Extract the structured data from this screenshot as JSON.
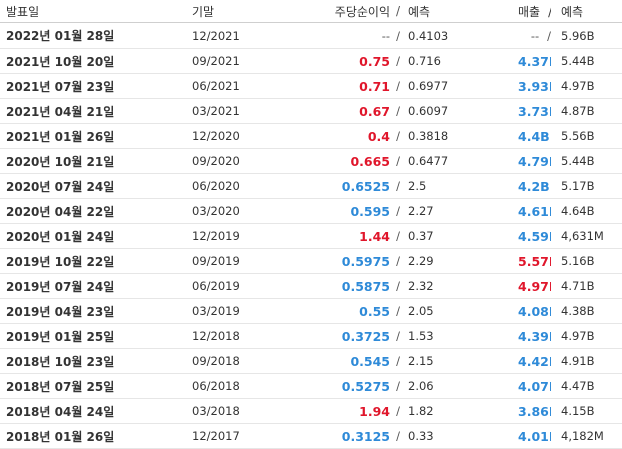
{
  "headers": {
    "date": "발표일",
    "period": "기말",
    "eps": "주당순이익",
    "eps_sep": "/",
    "eps_forecast": "예측",
    "revenue": "매출",
    "rev_sep": "/",
    "rev_forecast": "예측"
  },
  "colors": {
    "beat": "#e0162b",
    "miss": "#2e8ad8"
  },
  "rows": [
    {
      "date": "2022년 01월 28일",
      "period": "12/2021",
      "eps": "--",
      "eps_status": "na",
      "eps_forecast": "0.4103",
      "revenue": "--",
      "rev_status": "na",
      "rev_forecast": "5.96B"
    },
    {
      "date": "2021년 10월 20일",
      "period": "09/2021",
      "eps": "0.75",
      "eps_status": "up",
      "eps_forecast": "0.716",
      "revenue": "4.37B",
      "rev_status": "down",
      "rev_forecast": "5.44B"
    },
    {
      "date": "2021년 07월 23일",
      "period": "06/2021",
      "eps": "0.71",
      "eps_status": "up",
      "eps_forecast": "0.6977",
      "revenue": "3.93B",
      "rev_status": "down",
      "rev_forecast": "4.97B"
    },
    {
      "date": "2021년 04월 21일",
      "period": "03/2021",
      "eps": "0.67",
      "eps_status": "up",
      "eps_forecast": "0.6097",
      "revenue": "3.73B",
      "rev_status": "down",
      "rev_forecast": "4.87B"
    },
    {
      "date": "2021년 01월 26일",
      "period": "12/2020",
      "eps": "0.4",
      "eps_status": "up",
      "eps_forecast": "0.3818",
      "revenue": "4.4B",
      "rev_status": "down",
      "rev_forecast": "5.56B"
    },
    {
      "date": "2020년 10월 21일",
      "period": "09/2020",
      "eps": "0.665",
      "eps_status": "up",
      "eps_forecast": "0.6477",
      "revenue": "4.79B",
      "rev_status": "down",
      "rev_forecast": "5.44B"
    },
    {
      "date": "2020년 07월 24일",
      "period": "06/2020",
      "eps": "0.6525",
      "eps_status": "down",
      "eps_forecast": "2.5",
      "revenue": "4.2B",
      "rev_status": "down",
      "rev_forecast": "5.17B"
    },
    {
      "date": "2020년 04월 22일",
      "period": "03/2020",
      "eps": "0.595",
      "eps_status": "down",
      "eps_forecast": "2.27",
      "revenue": "4.61B",
      "rev_status": "down",
      "rev_forecast": "4.64B"
    },
    {
      "date": "2020년 01월 24일",
      "period": "12/2019",
      "eps": "1.44",
      "eps_status": "up",
      "eps_forecast": "0.37",
      "revenue": "4.59B",
      "rev_status": "down",
      "rev_forecast": "4,631M"
    },
    {
      "date": "2019년 10월 22일",
      "period": "09/2019",
      "eps": "0.5975",
      "eps_status": "down",
      "eps_forecast": "2.29",
      "revenue": "5.57B",
      "rev_status": "up",
      "rev_forecast": "5.16B"
    },
    {
      "date": "2019년 07월 24일",
      "period": "06/2019",
      "eps": "0.5875",
      "eps_status": "down",
      "eps_forecast": "2.32",
      "revenue": "4.97B",
      "rev_status": "up",
      "rev_forecast": "4.71B"
    },
    {
      "date": "2019년 04월 23일",
      "period": "03/2019",
      "eps": "0.55",
      "eps_status": "down",
      "eps_forecast": "2.05",
      "revenue": "4.08B",
      "rev_status": "down",
      "rev_forecast": "4.38B"
    },
    {
      "date": "2019년 01월 25일",
      "period": "12/2018",
      "eps": "0.3725",
      "eps_status": "down",
      "eps_forecast": "1.53",
      "revenue": "4.39B",
      "rev_status": "down",
      "rev_forecast": "4.97B"
    },
    {
      "date": "2018년 10월 23일",
      "period": "09/2018",
      "eps": "0.545",
      "eps_status": "down",
      "eps_forecast": "2.15",
      "revenue": "4.42B",
      "rev_status": "down",
      "rev_forecast": "4.91B"
    },
    {
      "date": "2018년 07월 25일",
      "period": "06/2018",
      "eps": "0.5275",
      "eps_status": "down",
      "eps_forecast": "2.06",
      "revenue": "4.07B",
      "rev_status": "down",
      "rev_forecast": "4.47B"
    },
    {
      "date": "2018년 04월 24일",
      "period": "03/2018",
      "eps": "1.94",
      "eps_status": "up",
      "eps_forecast": "1.82",
      "revenue": "3.86B",
      "rev_status": "down",
      "rev_forecast": "4.15B"
    },
    {
      "date": "2018년 01월 26일",
      "period": "12/2017",
      "eps": "0.3125",
      "eps_status": "down",
      "eps_forecast": "0.33",
      "revenue": "4.01B",
      "rev_status": "down",
      "rev_forecast": "4,182M"
    }
  ]
}
